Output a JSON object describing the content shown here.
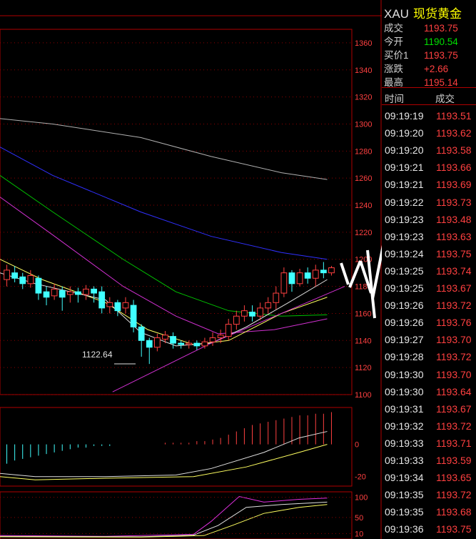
{
  "quote": {
    "symbol": "XAU",
    "name": "现货黄金",
    "rows": [
      {
        "label": "成交",
        "value": "1193.75",
        "color": "#ff4040"
      },
      {
        "label": "今开",
        "value": "1190.54",
        "color": "#00e000"
      },
      {
        "label": "买价1",
        "value": "1193.75",
        "color": "#ff4040"
      },
      {
        "label": "涨跌",
        "value": "+2.66",
        "color": "#ff4040"
      },
      {
        "label": "最高",
        "value": "1195.14",
        "color": "#ff4040"
      }
    ]
  },
  "ticks": {
    "headers": {
      "time": "时间",
      "price": "成交"
    },
    "rows": [
      {
        "time": "09:19:19",
        "price": "1193.51"
      },
      {
        "time": "09:19:20",
        "price": "1193.62"
      },
      {
        "time": "09:19:20",
        "price": "1193.58"
      },
      {
        "time": "09:19:21",
        "price": "1193.66"
      },
      {
        "time": "09:19:21",
        "price": "1193.69"
      },
      {
        "time": "09:19:22",
        "price": "1193.73"
      },
      {
        "time": "09:19:23",
        "price": "1193.48"
      },
      {
        "time": "09:19:23",
        "price": "1193.63"
      },
      {
        "time": "09:19:24",
        "price": "1193.75"
      },
      {
        "time": "09:19:25",
        "price": "1193.74"
      },
      {
        "time": "09:19:25",
        "price": "1193.67"
      },
      {
        "time": "09:19:26",
        "price": "1193.72"
      },
      {
        "time": "09:19:26",
        "price": "1193.76"
      },
      {
        "time": "09:19:27",
        "price": "1193.70"
      },
      {
        "time": "09:19:28",
        "price": "1193.72"
      },
      {
        "time": "09:19:30",
        "price": "1193.70"
      },
      {
        "time": "09:19:30",
        "price": "1193.64"
      },
      {
        "time": "09:19:31",
        "price": "1193.67"
      },
      {
        "time": "09:19:32",
        "price": "1193.72"
      },
      {
        "time": "09:19:33",
        "price": "1193.71"
      },
      {
        "time": "09:19:33",
        "price": "1193.59"
      },
      {
        "time": "09:19:34",
        "price": "1193.65"
      },
      {
        "time": "09:19:35",
        "price": "1193.72"
      },
      {
        "time": "09:19:35",
        "price": "1193.68"
      },
      {
        "time": "09:19:36",
        "price": "1193.75"
      }
    ]
  },
  "chart_data": [
    {
      "type": "candlestick",
      "y_ticks": [
        1360,
        1340,
        1320,
        1300,
        1280,
        1260,
        1240,
        1220,
        1200,
        1180,
        1160,
        1140,
        1120,
        1100
      ],
      "ylim": [
        1100,
        1370
      ],
      "annotation": "1122.64",
      "candles": [
        [
          1185,
          1192,
          1180,
          1196
        ],
        [
          1190,
          1186,
          1183,
          1195
        ],
        [
          1187,
          1182,
          1178,
          1190
        ],
        [
          1182,
          1188,
          1179,
          1192
        ],
        [
          1186,
          1175,
          1170,
          1188
        ],
        [
          1176,
          1172,
          1166,
          1180
        ],
        [
          1173,
          1178,
          1170,
          1182
        ],
        [
          1177,
          1172,
          1162,
          1180
        ],
        [
          1174,
          1176,
          1168,
          1180
        ],
        [
          1176,
          1174,
          1168,
          1179
        ],
        [
          1174,
          1178,
          1170,
          1181
        ],
        [
          1178,
          1175,
          1168,
          1180
        ],
        [
          1176,
          1164,
          1160,
          1180
        ],
        [
          1165,
          1168,
          1160,
          1172
        ],
        [
          1168,
          1162,
          1158,
          1170
        ],
        [
          1164,
          1168,
          1160,
          1172
        ],
        [
          1166,
          1150,
          1146,
          1170
        ],
        [
          1150,
          1140,
          1128,
          1152
        ],
        [
          1140,
          1135,
          1122.64,
          1142
        ],
        [
          1135,
          1142,
          1132,
          1145
        ],
        [
          1141,
          1144,
          1138,
          1147
        ],
        [
          1143,
          1138,
          1134,
          1146
        ],
        [
          1138,
          1137,
          1134,
          1140
        ],
        [
          1137,
          1138,
          1134,
          1140
        ],
        [
          1138,
          1136,
          1133,
          1140
        ],
        [
          1136,
          1139,
          1134,
          1142
        ],
        [
          1139,
          1142,
          1136,
          1146
        ],
        [
          1142,
          1144,
          1138,
          1148
        ],
        [
          1143,
          1152,
          1140,
          1156
        ],
        [
          1152,
          1158,
          1148,
          1162
        ],
        [
          1158,
          1162,
          1154,
          1166
        ],
        [
          1161,
          1158,
          1154,
          1166
        ],
        [
          1158,
          1164,
          1155,
          1168
        ],
        [
          1164,
          1168,
          1160,
          1172
        ],
        [
          1168,
          1175,
          1163,
          1180
        ],
        [
          1175,
          1190,
          1172,
          1194
        ],
        [
          1190,
          1182,
          1176,
          1192
        ],
        [
          1182,
          1190,
          1180,
          1193
        ],
        [
          1190,
          1186,
          1182,
          1194
        ],
        [
          1186,
          1192,
          1180,
          1196
        ],
        [
          1192,
          1190,
          1186,
          1198
        ],
        [
          1190,
          1193.75,
          1188,
          1195.14
        ]
      ],
      "ma_lines": [
        {
          "color": "#b0b0b0",
          "values": [
            [
              0,
              1304
            ],
            [
              0.15,
              1300
            ],
            [
              0.4,
              1290
            ],
            [
              0.6,
              1276
            ],
            [
              0.8,
              1264
            ],
            [
              0.93,
              1259
            ]
          ]
        },
        {
          "color": "#3030ff",
          "values": [
            [
              0,
              1283
            ],
            [
              0.15,
              1262
            ],
            [
              0.4,
              1235
            ],
            [
              0.6,
              1217
            ],
            [
              0.8,
              1205
            ],
            [
              0.93,
              1200
            ]
          ]
        },
        {
          "color": "#00c000",
          "values": [
            [
              0,
              1262
            ],
            [
              0.15,
              1235
            ],
            [
              0.35,
              1200
            ],
            [
              0.5,
              1176
            ],
            [
              0.65,
              1162
            ],
            [
              0.8,
              1158
            ],
            [
              0.93,
              1159
            ]
          ]
        },
        {
          "color": "#d030d0",
          "values": [
            [
              0,
              1246
            ],
            [
              0.15,
              1218
            ],
            [
              0.35,
              1180
            ],
            [
              0.5,
              1158
            ],
            [
              0.62,
              1145
            ],
            [
              0.78,
              1148
            ],
            [
              0.93,
              1156
            ]
          ]
        },
        {
          "color": "#ffff60",
          "values": [
            [
              0,
              1200
            ],
            [
              0.12,
              1185
            ],
            [
              0.3,
              1168
            ],
            [
              0.42,
              1148
            ],
            [
              0.55,
              1137
            ],
            [
              0.65,
              1140
            ],
            [
              0.8,
              1160
            ],
            [
              0.93,
              1172
            ]
          ]
        },
        {
          "color": "#e0e0e0",
          "values": [
            [
              0,
              1190
            ],
            [
              0.1,
              1182
            ],
            [
              0.3,
              1170
            ],
            [
              0.4,
              1146
            ],
            [
              0.5,
              1136
            ],
            [
              0.6,
              1138
            ],
            [
              0.7,
              1150
            ],
            [
              0.82,
              1168
            ],
            [
              0.93,
              1185
            ]
          ]
        },
        {
          "color": "#d030d0",
          "values": [
            [
              0.32,
              1102
            ],
            [
              0.6,
              1138
            ],
            [
              0.8,
              1160
            ],
            [
              0.98,
              1180
            ]
          ]
        }
      ]
    },
    {
      "type": "bar",
      "y_ticks": [
        0,
        -20
      ],
      "ylim": [
        -25,
        22
      ],
      "histogram": [
        -12,
        -10,
        -9,
        -8,
        -7,
        -6,
        -5,
        -4,
        -3,
        -2,
        -2,
        -1,
        -1,
        -1,
        0,
        0,
        0,
        0,
        0,
        0,
        1,
        1,
        1,
        1,
        2,
        2,
        3,
        4,
        6,
        8,
        10,
        12,
        13,
        14,
        15,
        16,
        17,
        18,
        18,
        19,
        19,
        20
      ],
      "lines": [
        {
          "color": "#e0e0e0",
          "values": [
            [
              0,
              -18
            ],
            [
              0.1,
              -20
            ],
            [
              0.3,
              -20
            ],
            [
              0.5,
              -19
            ],
            [
              0.6,
              -15
            ],
            [
              0.75,
              -5
            ],
            [
              0.85,
              4
            ],
            [
              0.93,
              8
            ]
          ]
        },
        {
          "color": "#ffff60",
          "values": [
            [
              0,
              -20
            ],
            [
              0.1,
              -22
            ],
            [
              0.3,
              -21
            ],
            [
              0.55,
              -20
            ],
            [
              0.7,
              -14
            ],
            [
              0.85,
              -5
            ],
            [
              0.93,
              0
            ]
          ]
        }
      ]
    },
    {
      "type": "line",
      "y_ticks": [
        100,
        50,
        10
      ],
      "ylim": [
        0,
        110
      ],
      "lines": [
        {
          "color": "#e030e0",
          "values": [
            [
              0,
              5
            ],
            [
              0.3,
              3
            ],
            [
              0.55,
              8
            ],
            [
              0.6,
              40
            ],
            [
              0.68,
              102
            ],
            [
              0.75,
              88
            ],
            [
              0.85,
              95
            ],
            [
              0.93,
              98
            ]
          ]
        },
        {
          "color": "#e0e0e0",
          "values": [
            [
              0,
              3
            ],
            [
              0.4,
              2
            ],
            [
              0.55,
              6
            ],
            [
              0.62,
              30
            ],
            [
              0.7,
              75
            ],
            [
              0.8,
              82
            ],
            [
              0.93,
              88
            ]
          ]
        },
        {
          "color": "#ffff60",
          "values": [
            [
              0,
              2
            ],
            [
              0.4,
              1
            ],
            [
              0.58,
              5
            ],
            [
              0.66,
              30
            ],
            [
              0.75,
              60
            ],
            [
              0.85,
              75
            ],
            [
              0.93,
              82
            ]
          ]
        }
      ]
    }
  ]
}
